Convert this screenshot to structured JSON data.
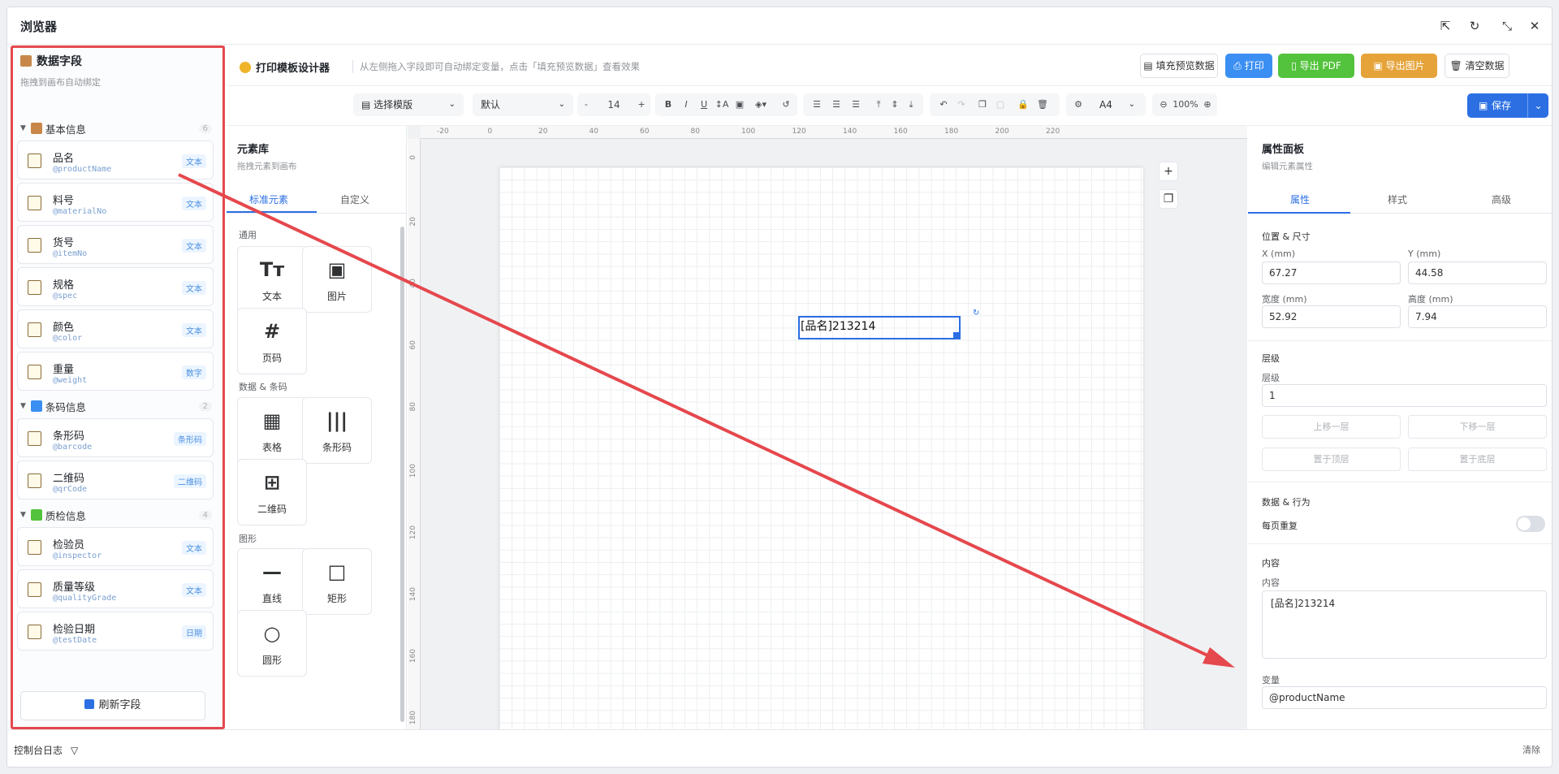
{
  "window": {
    "title": "浏览器"
  },
  "fields_panel": {
    "title": "数据字段",
    "subtitle": "拖拽到画布自动绑定",
    "groups": [
      {
        "label": "基本信息",
        "count": "6",
        "fields": [
          {
            "name": "品名",
            "var": "@productName",
            "tag": "文本"
          },
          {
            "name": "料号",
            "var": "@materialNo",
            "tag": "文本"
          },
          {
            "name": "货号",
            "var": "@itemNo",
            "tag": "文本"
          },
          {
            "name": "规格",
            "var": "@spec",
            "tag": "文本"
          },
          {
            "name": "颜色",
            "var": "@color",
            "tag": "文本"
          },
          {
            "name": "重量",
            "var": "@weight",
            "tag": "数字"
          }
        ]
      },
      {
        "label": "条码信息",
        "count": "2",
        "fields": [
          {
            "name": "条形码",
            "var": "@barcode",
            "tag": "条形码"
          },
          {
            "name": "二维码",
            "var": "@qrCode",
            "tag": "二维码"
          }
        ]
      },
      {
        "label": "质检信息",
        "count": "4",
        "fields": [
          {
            "name": "检验员",
            "var": "@inspector",
            "tag": "文本"
          },
          {
            "name": "质量等级",
            "var": "@qualityGrade",
            "tag": "文本"
          },
          {
            "name": "检验日期",
            "var": "@testDate",
            "tag": "日期"
          }
        ]
      }
    ],
    "refresh_label": "刷新字段"
  },
  "header": {
    "app_name": "打印模板设计器",
    "hint": "从左侧拖入字段即可自动绑定变量，点击「填充预览数据」查看效果",
    "fill_label": "填充预览数据",
    "print_label": "打印",
    "pdf_label": "导出 PDF",
    "image_label": "导出图片",
    "clear_label": "清空数据"
  },
  "toolbar": {
    "template_select": "选择模版",
    "font_select": "默认",
    "font_size": "14",
    "paper_size": "A4",
    "zoom": "100%",
    "save_label": "保存"
  },
  "library": {
    "title": "元素库",
    "subtitle": "拖拽元素到画布",
    "tabs": [
      "标准元素",
      "自定义"
    ],
    "sections": [
      {
        "label": "通用",
        "items": [
          {
            "icon": "Tт",
            "label": "文本"
          },
          {
            "icon": "▣",
            "label": "图片"
          },
          {
            "icon": "#",
            "label": "页码"
          }
        ]
      },
      {
        "label": "数据 & 条码",
        "items": [
          {
            "icon": "▦",
            "label": "表格"
          },
          {
            "icon": "|||",
            "label": "条形码"
          },
          {
            "icon": "⊞",
            "label": "二维码"
          }
        ]
      },
      {
        "label": "图形",
        "items": [
          {
            "icon": "—",
            "label": "直线"
          },
          {
            "icon": "□",
            "label": "矩形"
          },
          {
            "icon": "○",
            "label": "圆形"
          }
        ]
      }
    ]
  },
  "canvas": {
    "ruler_top": [
      "-20",
      "0",
      "20",
      "40",
      "60",
      "80",
      "100",
      "120",
      "140",
      "160",
      "180",
      "200",
      "220"
    ],
    "ruler_left": [
      "0",
      "20",
      "40",
      "60",
      "80",
      "100",
      "120",
      "140",
      "160",
      "180"
    ],
    "element_text": "[品名]213214"
  },
  "properties": {
    "title": "属性面板",
    "subtitle": "编辑元素属性",
    "tabs": [
      "属性",
      "样式",
      "高级"
    ],
    "pos_section": "位置 & 尺寸",
    "x_label": "X (mm)",
    "x_value": "67.27",
    "y_label": "Y (mm)",
    "y_value": "44.58",
    "w_label": "宽度 (mm)",
    "w_value": "52.92",
    "h_label": "高度 (mm)",
    "h_value": "7.94",
    "layer_section": "层级",
    "layer_label": "层级",
    "layer_value": "1",
    "up_label": "上移一层",
    "down_label": "下移一层",
    "top_label": "置于顶层",
    "bottom_label": "置于底层",
    "data_section": "数据 & 行为",
    "repeat_label": "每页重复",
    "content_section": "内容",
    "content_label": "内容",
    "content_value": "[品名]213214",
    "var_label": "变量",
    "var_value": "@productName"
  },
  "statusbar": {
    "log_label": "控制台日志",
    "clear_label": "清除"
  },
  "colors": {
    "accent": "#2b6fe3",
    "print": "#3b8ff2",
    "pdf": "#53c23c",
    "image": "#e5a33a",
    "highlight": "#e5484d"
  }
}
